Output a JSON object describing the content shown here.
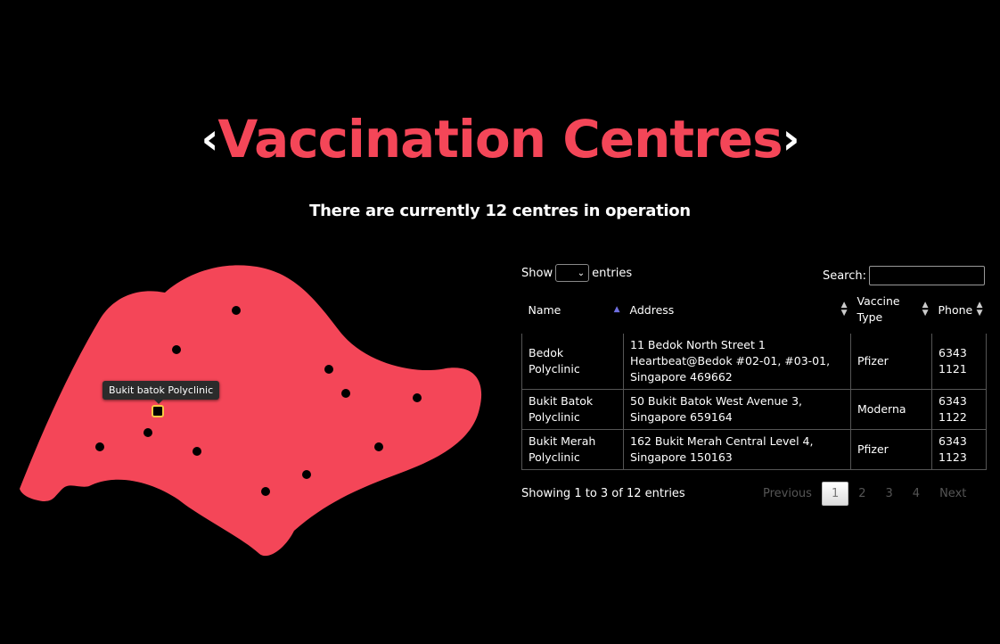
{
  "header": {
    "title": "Vaccination Centres",
    "chevron_left": "‹",
    "chevron_right": "›",
    "subtitle": "There are currently 12 centres in operation"
  },
  "map": {
    "fill_color": "#f44658",
    "tooltip": "Bukit batok Polyclinic",
    "marker_count": 12
  },
  "table_controls": {
    "show_label": "Show",
    "entries_label": "entries",
    "length_value": "",
    "search_label": "Search:"
  },
  "table": {
    "columns": [
      "Name",
      "Address",
      "Vaccine Type",
      "Phone"
    ],
    "rows": [
      [
        "Bedok Polyclinic",
        "11 Bedok North Street 1 Heartbeat@Bedok #02-01, #03-01, Singapore 469662",
        "Pfizer",
        "6343 1121"
      ],
      [
        "Bukit Batok Polyclinic",
        "50 Bukit Batok West Avenue 3, Singapore 659164",
        "Moderna",
        "6343 1122"
      ],
      [
        "Bukit Merah Polyclinic",
        "162 Bukit Merah Central Level 4, Singapore 150163",
        "Pfizer",
        "6343 1123"
      ]
    ]
  },
  "pagination": {
    "info": "Showing 1 to 3 of 12 entries",
    "previous": "Previous",
    "pages": [
      "1",
      "2",
      "3",
      "4"
    ],
    "next": "Next"
  },
  "colors": {
    "accent": "#f44658",
    "background": "#000000"
  }
}
